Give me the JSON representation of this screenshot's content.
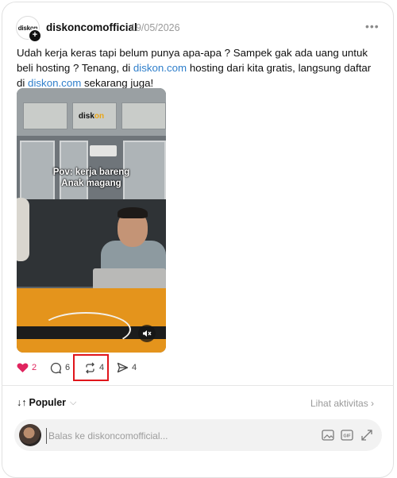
{
  "post": {
    "author": "diskoncomofficial",
    "date": "19/05/2026",
    "more_label": "•••",
    "avatar_logo_main": "diskon",
    "text_part1": "Udah kerja keras tapi belum punya apa-apa ? Sampek gak ada uang untuk beli hosting ? Tenang, di ",
    "link1": "diskon.com",
    "text_part2": " hosting dari kita gratis, langsung daftar di ",
    "link2": "diskon.com",
    "text_part3": " sekarang juga!",
    "video": {
      "brand_main": "disk",
      "brand_accent": "on",
      "caption_line1": "Pov: kerja bareng",
      "caption_line2": "Anak magang"
    }
  },
  "actions": {
    "likes": "2",
    "comments": "6",
    "reposts": "4",
    "shares": "4",
    "like_color": "#e0245e"
  },
  "sort": {
    "label": "Populer",
    "icon": "sort-arrows-icon"
  },
  "activity_link": "Lihat aktivitas",
  "reply": {
    "placeholder": "Balas ke diskoncomofficial..."
  },
  "icons": [
    "more-icon",
    "heart-icon",
    "comment-icon",
    "repost-icon",
    "share-icon",
    "mute-icon",
    "image-icon",
    "gif-icon",
    "expand-icon"
  ]
}
